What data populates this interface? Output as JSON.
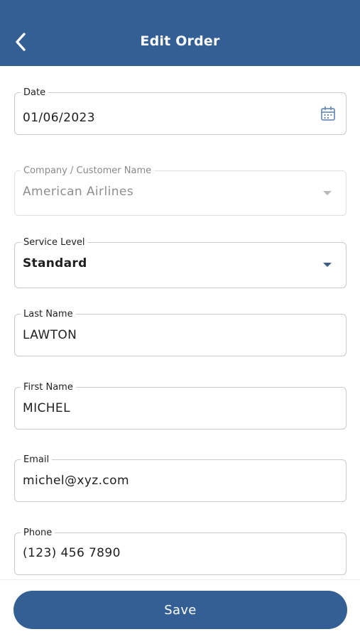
{
  "header": {
    "title": "Edit Order",
    "background": "#335f94"
  },
  "form": {
    "date": {
      "label": "Date",
      "value": "01/06/2023"
    },
    "company": {
      "label": "Company / Customer Name",
      "value": "American Airlines"
    },
    "service_level": {
      "label": "Service Level",
      "value": "Standard"
    },
    "last_name": {
      "label": "Last Name",
      "value": "LAWTON"
    },
    "first_name": {
      "label": "First Name",
      "value": "MICHEL"
    },
    "email": {
      "label": "Email",
      "value": "michel@xyz.com"
    },
    "phone": {
      "label": "Phone",
      "value": "(123) 456 7890"
    }
  },
  "footer": {
    "save_label": "Save"
  },
  "icons": {
    "back": "chevron-left-icon",
    "calendar": "calendar-icon",
    "dropdown": "caret-down-icon"
  }
}
